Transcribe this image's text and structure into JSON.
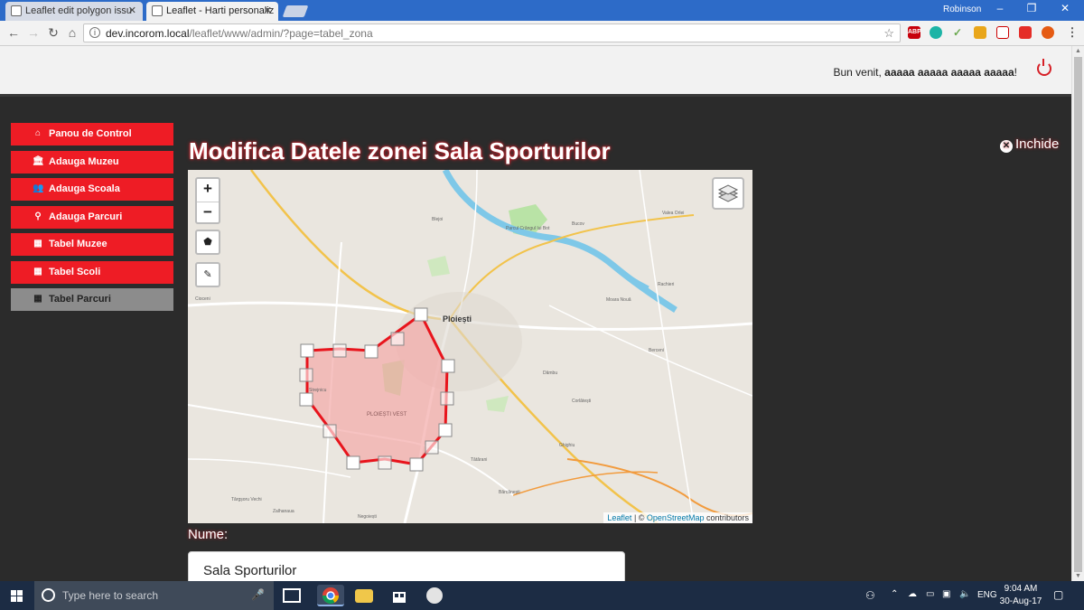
{
  "browser": {
    "tabs": [
      {
        "title": "Leaflet edit polygon issu",
        "active": false
      },
      {
        "title": "Leaflet - Harti personaliz",
        "active": true
      }
    ],
    "user": "Robinson",
    "url_host": "dev.incorom.local",
    "url_path": "/leaflet/www/admin/?page=tabel_zona",
    "extensions": [
      "ABP"
    ]
  },
  "header": {
    "welcome_prefix": "Bun venit, ",
    "user_name": "aaaaa aaaaa aaaaa aaaaa",
    "welcome_suffix": "!"
  },
  "sidebar": {
    "items": [
      {
        "label": "Panou de Control",
        "icon": "home-icon"
      },
      {
        "label": "Adauga Muzeu",
        "icon": "museum-icon"
      },
      {
        "label": "Adauga Scoala",
        "icon": "users-icon"
      },
      {
        "label": "Adauga Parcuri",
        "icon": "map-marker-icon"
      },
      {
        "label": "Tabel Muzee",
        "icon": "table-icon"
      },
      {
        "label": "Tabel Scoli",
        "icon": "table-icon"
      },
      {
        "label": "Tabel Parcuri",
        "icon": "table-icon"
      }
    ]
  },
  "main": {
    "title": "Modifica Datele zonei Sala Sporturilor",
    "close_label": "Inchide",
    "form": {
      "name_label": "Nume:",
      "name_value": "Sala Sporturilor"
    }
  },
  "map": {
    "zoom_in": "+",
    "zoom_out": "−",
    "attribution_leaflet": "Leaflet",
    "attribution_sep": " | © ",
    "attribution_osm": "OpenStreetMap",
    "attribution_suffix": " contributors",
    "labels": {
      "city": "Ploiești",
      "district": "PLOIEȘTI VEST",
      "parc": "Parcul Crângul lui Bot",
      "targsor": "Târgșoru Vechi",
      "blejoi": "Blejoi",
      "bucov": "Bucov",
      "valea_orlei": "Valea Orlei",
      "rachieri": "Rachieri",
      "bercen": "Berceni",
      "carbunesti": "Corlătești",
      "barcanesti": "Bărcănești",
      "tatarani": "Tătărani",
      "stejaru": "Strejnicu",
      "moara_noua": "Moara Nouă",
      "dambu": "Dâmbu",
      "ghighiu": "Ghighiu",
      "negoiesti": "Negoiești",
      "zalhanaua": "Zalhanaua",
      "cioceni": "Cioceni"
    },
    "colors": {
      "polygon_stroke": "#e8141c",
      "polygon_fill": "#f4a9a8",
      "river": "#7ec8e8",
      "park": "#b9e3a6",
      "major_road": "#f2c34b",
      "orange_road": "#f29b3d"
    }
  },
  "taskbar": {
    "search_placeholder": "Type here to search",
    "language": "ENG",
    "time": "9:04 AM",
    "date": "30-Aug-17"
  }
}
